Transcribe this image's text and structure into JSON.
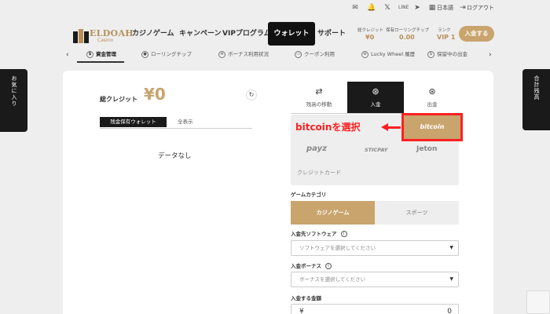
{
  "utility": {
    "lang": "日本語",
    "logout": "ログアウト"
  },
  "logo": {
    "name": "ELDOAH",
    "sub": "Casino"
  },
  "nav": {
    "items": [
      "カジノゲーム",
      "キャンペーン",
      "VIPプログラム",
      "ウォレット",
      "サポート"
    ]
  },
  "stats": {
    "credit_label": "総クレジット",
    "credit_value": "¥0",
    "rolling_label": "保有ローリングチップ",
    "rolling_value": "0.00",
    "rank_label": "ランク",
    "rank_value": "VIP 1",
    "deposit_button": "入金する"
  },
  "subtabs": [
    "資金管理",
    "ローリングチップ",
    "ボーナス利用状況",
    "クーポン利用",
    "Lucky Wheel 履歴",
    "保留中の出金"
  ],
  "side": {
    "left": "お気に入り",
    "right": "合計残高"
  },
  "wallet": {
    "total_label": "総クレジット",
    "total_value": "¥0",
    "tab_active": "残金保有ウォレット",
    "tab_all": "全表示",
    "empty": "データなし"
  },
  "panel": {
    "tabs": [
      "残高の移動",
      "入金",
      "出金"
    ],
    "methods": {
      "bitcoin": "bitcoin",
      "payz": "payz",
      "sticpay": "STICPAY",
      "jeton": "Jeton",
      "credit": "クレジットカード"
    },
    "annotation": "bitcoinを選択",
    "category_label": "ゲームカテゴリ",
    "category_active": "カジノゲーム",
    "category_other": "スポーツ",
    "software_label": "入金先ソフトウェア",
    "software_placeholder": "ソフトウェアを選択してください",
    "bonus_label": "入金ボーナス",
    "bonus_placeholder": "ボーナスを選択してください",
    "amount_label": "入金する金額",
    "amount_currency": "¥",
    "amount_value": "0"
  }
}
